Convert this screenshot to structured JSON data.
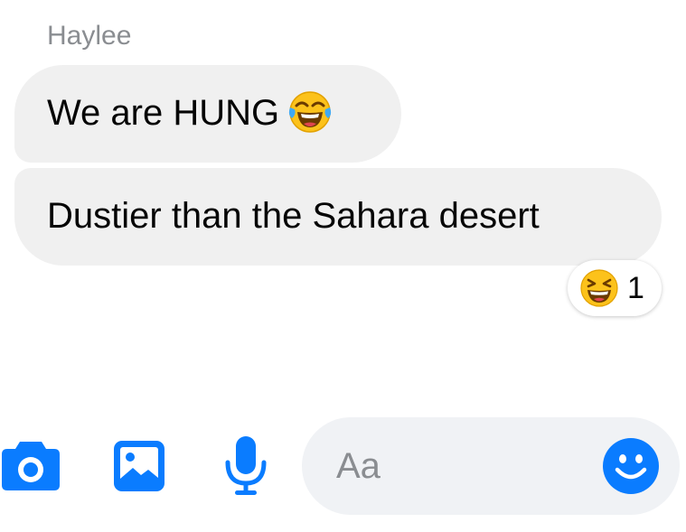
{
  "conversation": {
    "sender_name": "Haylee",
    "messages": [
      {
        "text": "We are HUNG",
        "emoji": "face-with-tears-of-joy"
      },
      {
        "text": "Dustier than the Sahara desert"
      }
    ],
    "reaction": {
      "emoji": "grinning-squinting-face",
      "count": "1"
    }
  },
  "composer": {
    "placeholder": "Aa",
    "buttons": [
      "camera-icon",
      "gallery-icon",
      "microphone-icon",
      "emoji-smiley-icon"
    ]
  },
  "colors": {
    "accent": "#0a7cff",
    "bubble": "#f0f0f0",
    "composer_bg": "#f0f2f5",
    "muted_text": "#8a8d91"
  }
}
